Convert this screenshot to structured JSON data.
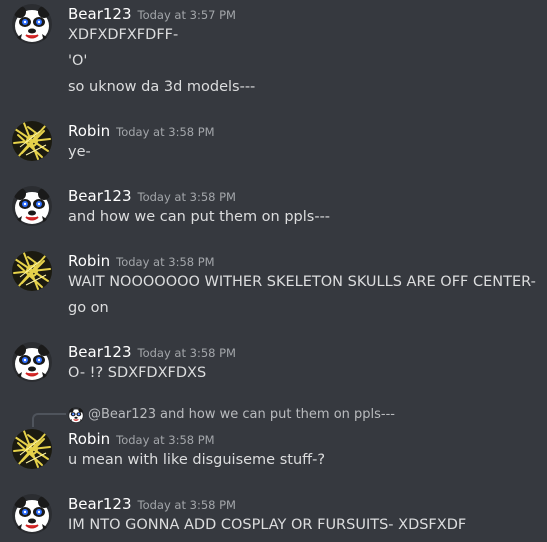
{
  "messages": [
    {
      "user": "Bear123",
      "time": "Today at 3:57 PM",
      "lines": [
        "XDFXDFXFDFF-",
        "'O'",
        "so uknow da 3d models---"
      ]
    },
    {
      "user": "Robin",
      "time": "Today at 3:58 PM",
      "lines": [
        "ye-"
      ]
    },
    {
      "user": "Bear123",
      "time": "Today at 3:58 PM",
      "lines": [
        "and how we can put them on ppls---"
      ]
    },
    {
      "user": "Robin",
      "time": "Today at 3:58 PM",
      "lines": [
        "WAIT NOOOOOOO WITHER SKELETON SKULLS ARE OFF CENTER-",
        "go on"
      ]
    },
    {
      "user": "Bear123",
      "time": "Today at 3:58 PM",
      "lines": [
        "O- !? SDXFDXFDXS"
      ]
    },
    {
      "user": "Robin",
      "time": "Today at 3:58 PM",
      "lines": [
        "u mean with like disguiseme stuff-?"
      ],
      "reply": {
        "user": "@Bear123",
        "text": "and how we can put them on ppls---"
      }
    },
    {
      "user": "Bear123",
      "time": "Today at 3:58 PM",
      "lines": [
        "IM NTO GONNA ADD COSPLAY OR FURSUITS- XDSFXDF"
      ]
    }
  ],
  "colors": {
    "background": "#36393f",
    "username": "#ffffff",
    "message_text": "#dcddde",
    "timestamp": "#a3a6aa"
  },
  "icons": {
    "bear_avatar": "panda-bear-avatar-icon",
    "robin_avatar": "yellow-scribble-avatar-icon"
  }
}
